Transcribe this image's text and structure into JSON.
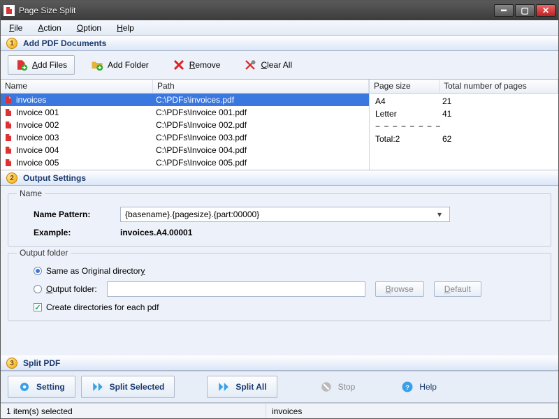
{
  "window": {
    "title": "Page Size Split"
  },
  "menu": {
    "file": "File",
    "action": "Action",
    "option": "Option",
    "help": "Help"
  },
  "section1": {
    "title": "Add PDF Documents",
    "num": "1"
  },
  "toolbar": {
    "add_files": "Add Files",
    "add_folder": "Add Folder",
    "remove": "Remove",
    "clear_all": "Clear All"
  },
  "filelist": {
    "col_name": "Name",
    "col_path": "Path",
    "items": [
      {
        "name": "invoices",
        "path": "C:\\PDFs\\invoices.pdf",
        "selected": true
      },
      {
        "name": "Invoice 001",
        "path": "C:\\PDFs\\Invoice 001.pdf",
        "selected": false
      },
      {
        "name": "Invoice 002",
        "path": "C:\\PDFs\\Invoice 002.pdf",
        "selected": false
      },
      {
        "name": "Invoice 003",
        "path": "C:\\PDFs\\Invoice 003.pdf",
        "selected": false
      },
      {
        "name": "Invoice 004",
        "path": "C:\\PDFs\\Invoice 004.pdf",
        "selected": false
      },
      {
        "name": "Invoice 005",
        "path": "C:\\PDFs\\Invoice 005.pdf",
        "selected": false
      }
    ]
  },
  "pagesizes": {
    "col_size": "Page size",
    "col_total": "Total number of pages",
    "rows": [
      {
        "size": "A4",
        "count": "21"
      },
      {
        "size": "Letter",
        "count": "41"
      }
    ],
    "divider": "− − − − − − − −",
    "total_label": "Total:2",
    "total_count": "62"
  },
  "section2": {
    "title": "Output Settings",
    "num": "2"
  },
  "output": {
    "name_legend": "Name",
    "pattern_label": "Name Pattern:",
    "pattern_value": "{basename}.{pagesize}.{part:00000}",
    "example_label": "Example:",
    "example_value": "invoices.A4.00001",
    "folder_legend": "Output folder",
    "same_dir": "Same as Original directory",
    "output_folder_label": "Output folder:",
    "browse": "Browse",
    "default": "Default",
    "create_dirs": "Create directories for each pdf"
  },
  "section3": {
    "title": "Split PDF",
    "num": "3"
  },
  "actions": {
    "setting": "Setting",
    "split_selected": "Split Selected",
    "split_all": "Split All",
    "stop": "Stop",
    "help": "Help"
  },
  "status": {
    "selection": "1 item(s) selected",
    "current": "invoices"
  }
}
